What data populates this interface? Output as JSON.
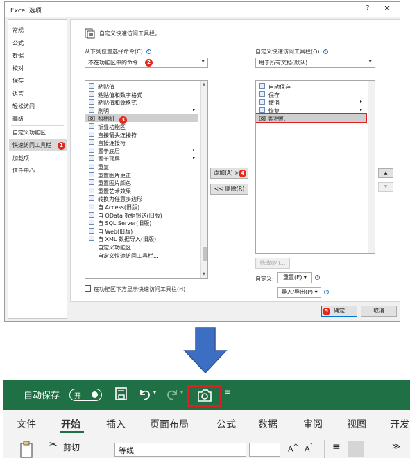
{
  "dialog": {
    "title": "Excel 选项",
    "help": "?",
    "close": "✕"
  },
  "nav": {
    "items": [
      "常规",
      "公式",
      "数据",
      "校对",
      "保存",
      "语言",
      "轻松访问",
      "高级",
      "自定义功能区",
      "快速访问工具栏",
      "加载项",
      "信任中心"
    ],
    "selected": "快速访问工具栏",
    "selected_badge": "1"
  },
  "main": {
    "heading": "自定义快速访问工具栏。",
    "choose_label": "从下列位置选择命令(C):",
    "choose_value": "不在功能区中的命令",
    "choose_badge": "2",
    "customize_label": "自定义快速访问工具栏(Q):",
    "customize_value": "用于所有文档(默认)",
    "commands": [
      {
        "label": "粘贴值",
        "icon": "paste-values-icon",
        "sub": ""
      },
      {
        "label": "粘贴值和数字格式",
        "icon": "paste-number-icon",
        "sub": ""
      },
      {
        "label": "粘贴值和源格式",
        "icon": "paste-source-icon",
        "sub": ""
      },
      {
        "label": "刷明",
        "icon": "brush-icon",
        "sub": "▸"
      },
      {
        "label": "照相机",
        "icon": "camera-icon",
        "sub": ""
      },
      {
        "label": "折叠功能区",
        "icon": "collapse-ribbon-icon",
        "sub": ""
      },
      {
        "label": "直接箭头连接符",
        "icon": "arrow-connector-icon",
        "sub": ""
      },
      {
        "label": "直接连接符",
        "icon": "line-connector-icon",
        "sub": ""
      },
      {
        "label": "置于底层",
        "icon": "send-back-icon",
        "sub": "▸"
      },
      {
        "label": "置于顶层",
        "icon": "bring-front-icon",
        "sub": "▸"
      },
      {
        "label": "重复",
        "icon": "repeat-icon",
        "sub": ""
      },
      {
        "label": "重置图片更正",
        "icon": "reset-picture-icon",
        "sub": ""
      },
      {
        "label": "重置图片颜色",
        "icon": "reset-color-icon",
        "sub": ""
      },
      {
        "label": "重置艺术效果",
        "icon": "reset-art-icon",
        "sub": ""
      },
      {
        "label": "转换为任意多边形",
        "icon": "polygon-icon",
        "sub": ""
      },
      {
        "label": "自 Access(旧版)",
        "icon": "access-icon",
        "sub": ""
      },
      {
        "label": "自 OData 数据馈送(旧版)",
        "icon": "odata-icon",
        "sub": ""
      },
      {
        "label": "自 SQL Server(旧版)",
        "icon": "sql-icon",
        "sub": ""
      },
      {
        "label": "自 Web(旧版)",
        "icon": "web-icon",
        "sub": ""
      },
      {
        "label": "自 XML 数据导入(旧版)",
        "icon": "xml-icon",
        "sub": ""
      },
      {
        "label": "自定义功能区",
        "icon": "",
        "sub": ""
      },
      {
        "label": "自定义快速访问工具栏...",
        "icon": "",
        "sub": ""
      }
    ],
    "camera_badge": "3",
    "qat_items": [
      {
        "label": "自动保存",
        "icon": "autosave-icon",
        "sub": ""
      },
      {
        "label": "保存",
        "icon": "save-icon",
        "sub": ""
      },
      {
        "label": "撤消",
        "icon": "undo-icon",
        "sub": "▸"
      },
      {
        "label": "恢复",
        "icon": "redo-icon",
        "sub": "▸"
      },
      {
        "label": "照相机",
        "icon": "camera-icon",
        "sub": ""
      }
    ],
    "add_button": "添加(A) >>",
    "add_badge": "4",
    "remove_button": "<< 删除(R)",
    "modify_button": "修改(M)...",
    "customize_label2": "自定义:",
    "reset_button": "重置(E) ▾",
    "import_button": "导入/导出(P) ▾",
    "show_below_label": "在功能区下方显示快速访问工具栏(H)",
    "ok_button": "确定",
    "ok_badge": "5",
    "cancel_button": "取消"
  },
  "ribbon": {
    "autosave": "自动保存",
    "toggle": "开",
    "tabs": [
      "文件",
      "开始",
      "插入",
      "页面布局",
      "公式",
      "数据",
      "审阅",
      "视图",
      "开发"
    ],
    "active_tab": "开始",
    "clipboard_label": "剪切",
    "font_box": "等线"
  },
  "colors": {
    "excel_green": "#1f7145",
    "highlight_red": "#e02020",
    "badge_red": "#e5281b",
    "arrow_blue": "#3c6fc4"
  }
}
